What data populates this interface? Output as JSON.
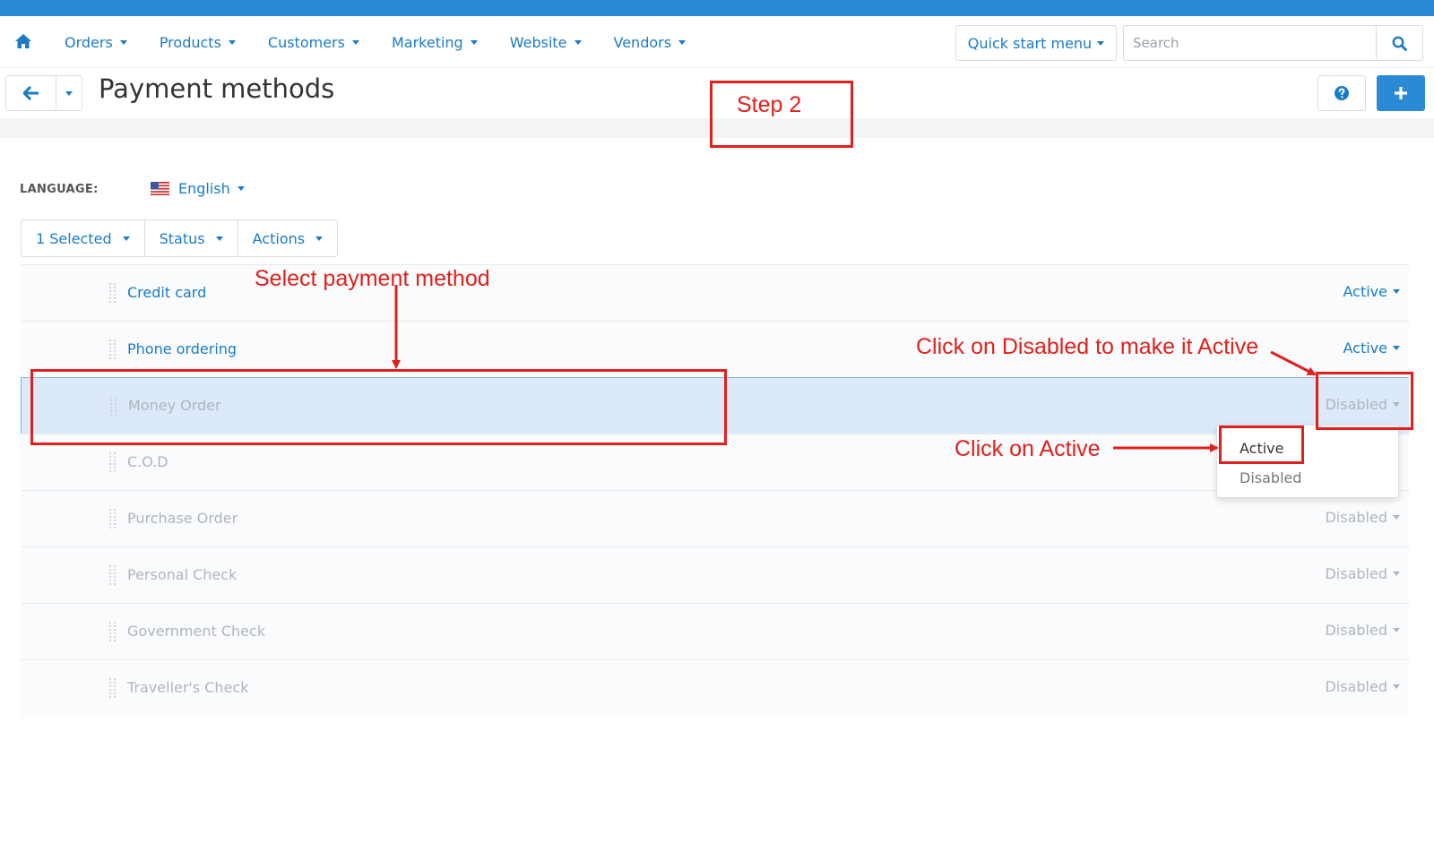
{
  "colors": {
    "brand": "#2b8ad6",
    "link": "#1a7bc5",
    "annotation": "#e0201d",
    "selected_row": "#dbe9fa"
  },
  "nav": {
    "home_icon": "home-icon",
    "items": [
      "Orders",
      "Products",
      "Customers",
      "Marketing",
      "Website",
      "Vendors"
    ],
    "quick_start": "Quick start menu",
    "search_placeholder": "Search",
    "search_icon": "search-icon"
  },
  "titlebar": {
    "title": "Payment methods",
    "back_icon": "arrow-left-icon",
    "help_icon": "question-circle-icon",
    "add_icon": "plus-icon"
  },
  "language": {
    "label": "LANGUAGE:",
    "value": "English",
    "flag_icon": "us-flag-icon"
  },
  "toolbar": {
    "selected": "1 Selected",
    "status": "Status",
    "actions": "Actions"
  },
  "rows": [
    {
      "name": "Credit card",
      "status": "Active"
    },
    {
      "name": "Phone ordering",
      "status": "Active"
    },
    {
      "name": "Money Order",
      "status": "Disabled"
    },
    {
      "name": "C.O.D",
      "status": ""
    },
    {
      "name": "Purchase Order",
      "status": "Disabled"
    },
    {
      "name": "Personal Check",
      "status": "Disabled"
    },
    {
      "name": "Government Check",
      "status": "Disabled"
    },
    {
      "name": "Traveller's Check",
      "status": "Disabled"
    }
  ],
  "dropdown": {
    "options": [
      "Active",
      "Disabled"
    ]
  },
  "annotations": {
    "step": "Step 2",
    "select_method": "Select payment method",
    "click_disabled": "Click on Disabled to make it Active",
    "click_active": "Click on Active"
  }
}
